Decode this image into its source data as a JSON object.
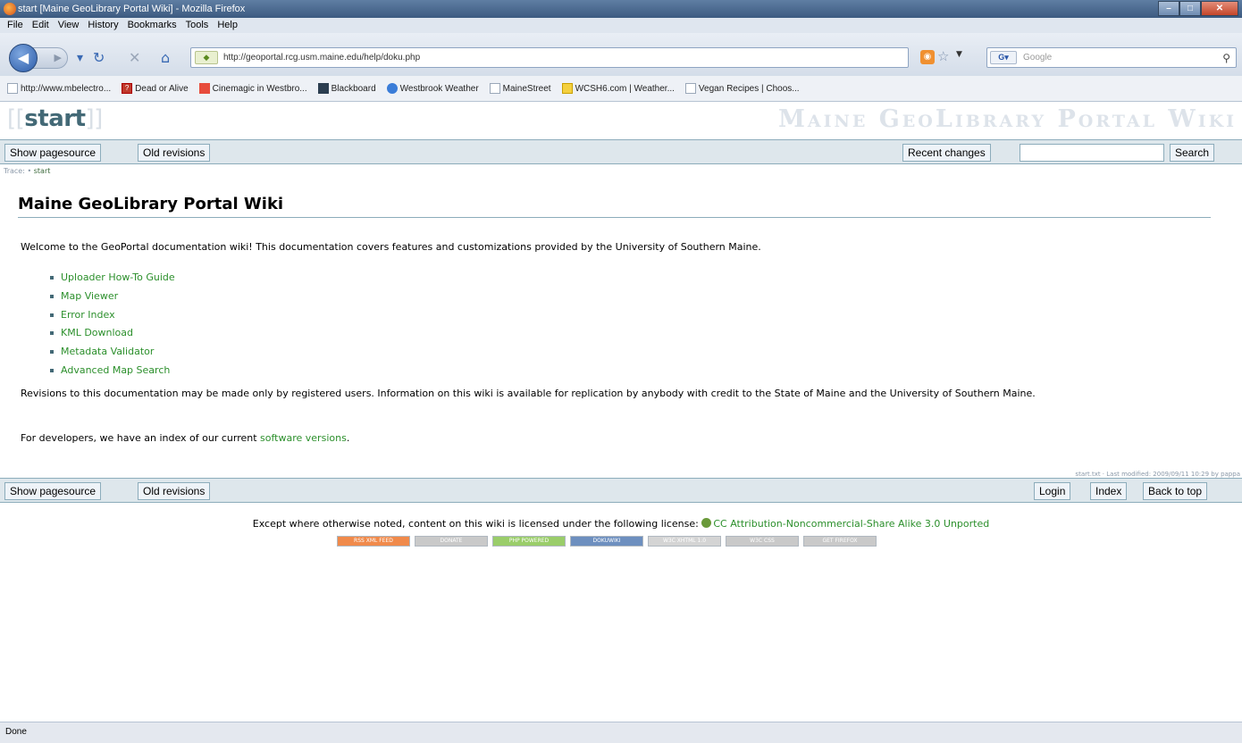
{
  "window": {
    "title": "start [Maine GeoLibrary Portal Wiki] - Mozilla Firefox"
  },
  "menu": [
    "File",
    "Edit",
    "View",
    "History",
    "Bookmarks",
    "Tools",
    "Help"
  ],
  "nav": {
    "url": "http://geoportal.rcg.usm.maine.edu/help/doku.php",
    "search_placeholder": "Google",
    "search_engine_label": "G"
  },
  "bookmarks": [
    {
      "label": "http://www.mbelectro...",
      "icon": "page-icon"
    },
    {
      "label": "Dead or Alive",
      "icon": "question-icon"
    },
    {
      "label": "Cinemagic in Westbro...",
      "icon": "cinema-icon"
    },
    {
      "label": "Blackboard",
      "icon": "blackboard-icon"
    },
    {
      "label": "Westbrook Weather",
      "icon": "weather-icon"
    },
    {
      "label": "MaineStreet",
      "icon": "page-icon"
    },
    {
      "label": "WCSH6.com | Weather...",
      "icon": "nbc-icon"
    },
    {
      "label": "Vegan Recipes | Choos...",
      "icon": "page-icon"
    }
  ],
  "wiki": {
    "pagename": "start",
    "logo": "Maine GeoLibrary Portal Wiki",
    "buttons": {
      "show_source": "Show pagesource",
      "old_revisions": "Old revisions",
      "recent_changes": "Recent changes",
      "search": "Search",
      "login": "Login",
      "index": "Index",
      "back_to_top": "Back to top"
    },
    "breadcrumbs_label": "Trace:",
    "breadcrumbs_item": "start",
    "heading": "Maine GeoLibrary Portal Wiki",
    "intro": "Welcome to the GeoPortal documentation wiki! This documentation covers features and customizations provided by the University of Southern Maine.",
    "links": [
      "Uploader How-To Guide",
      "Map Viewer",
      "Error Index",
      "KML Download",
      "Metadata Validator",
      "Advanced Map Search"
    ],
    "revisions_note": "Revisions to this documentation may be made only by registered users. Information on this wiki is available for replication by anybody with credit to the State of Maine and the University of Southern Maine.",
    "developers_prefix": "For developers, we have an index of our current",
    "developers_link": "software versions",
    "developers_suffix": ".",
    "docinfo": "start.txt · Last modified: 2009/09/11 10:29 by pappa",
    "license_prefix": "Except where otherwise noted, content on this wiki is licensed under the following license:",
    "license_link": "CC Attribution-Noncommercial-Share Alike 3.0 Unported",
    "badges": [
      {
        "label": "RSS XML FEED",
        "color": "#f08a4b"
      },
      {
        "label": "DONATE",
        "color": "#c9c9c9"
      },
      {
        "label": "PHP POWERED",
        "color": "#9acd6a"
      },
      {
        "label": "DOKUWIKI",
        "color": "#6d8fbf"
      },
      {
        "label": "W3C XHTML 1.0",
        "color": "#d4d4d4"
      },
      {
        "label": "W3C CSS",
        "color": "#c9c9c9"
      },
      {
        "label": "GET FIREFOX",
        "color": "#c9c9c9"
      }
    ]
  },
  "status": "Done"
}
